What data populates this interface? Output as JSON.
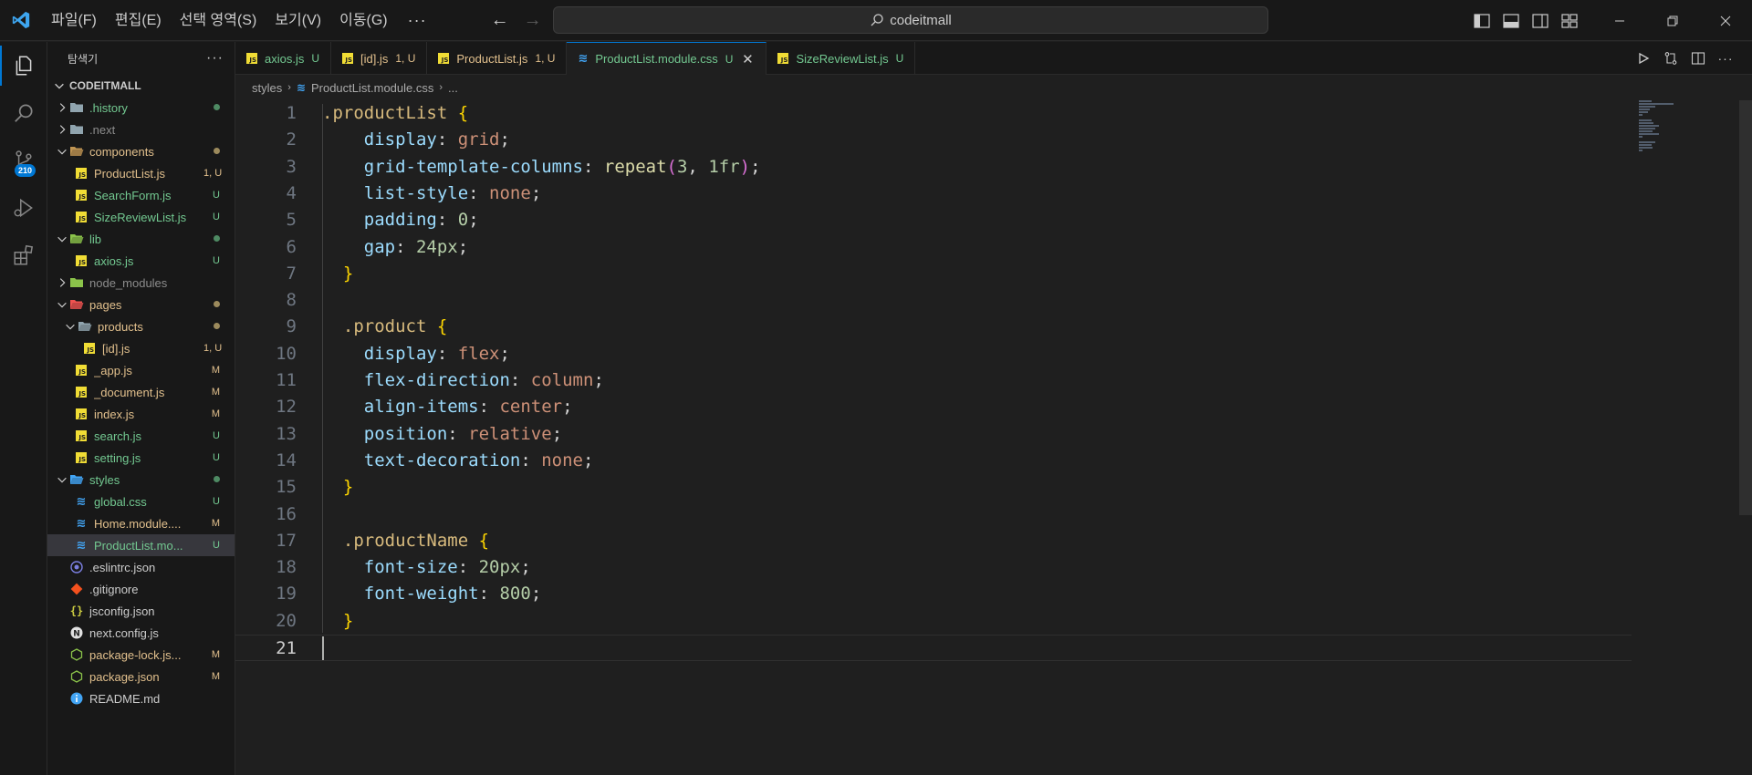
{
  "titlebar": {
    "menu": [
      "파일(F)",
      "편집(E)",
      "선택 영역(S)",
      "보기(V)",
      "이동(G)"
    ],
    "more": "···",
    "search_text": "codeitmall"
  },
  "activity": {
    "scm_badge": "210"
  },
  "sidebar": {
    "header": "탐색기",
    "more": "···",
    "root": "CODEITMALL"
  },
  "tree": [
    {
      "label": ".history",
      "type": "folder",
      "depth": 1,
      "open": false,
      "color": "untracked",
      "status": "dot",
      "icon": "folder-icon"
    },
    {
      "label": ".next",
      "type": "folder",
      "depth": 1,
      "open": false,
      "color": "ignored",
      "status": "",
      "icon": "folder-icon"
    },
    {
      "label": "components",
      "type": "folder",
      "depth": 1,
      "open": true,
      "color": "modified",
      "status": "dot",
      "icon": "folder-open-icon"
    },
    {
      "label": "ProductList.js",
      "type": "js",
      "depth": 2,
      "color": "modified",
      "status": "1, U",
      "icon": "js-file-icon"
    },
    {
      "label": "SearchForm.js",
      "type": "js",
      "depth": 2,
      "color": "untracked",
      "status": "U",
      "icon": "js-file-icon"
    },
    {
      "label": "SizeReviewList.js",
      "type": "js",
      "depth": 2,
      "color": "untracked",
      "status": "U",
      "icon": "js-file-icon"
    },
    {
      "label": "lib",
      "type": "folder",
      "depth": 1,
      "open": true,
      "color": "untracked",
      "status": "dot",
      "icon": "folder-open-icon"
    },
    {
      "label": "axios.js",
      "type": "js",
      "depth": 2,
      "color": "untracked",
      "status": "U",
      "icon": "js-file-icon"
    },
    {
      "label": "node_modules",
      "type": "folder",
      "depth": 1,
      "open": false,
      "color": "ignored",
      "status": "",
      "icon": "folder-icon"
    },
    {
      "label": "pages",
      "type": "folder",
      "depth": 1,
      "open": true,
      "color": "modified",
      "status": "dot",
      "icon": "folder-open-icon"
    },
    {
      "label": "products",
      "type": "folder",
      "depth": 2,
      "open": true,
      "color": "modified",
      "status": "dot",
      "icon": "folder-open-icon"
    },
    {
      "label": "[id].js",
      "type": "js",
      "depth": 3,
      "color": "modified",
      "status": "1, U",
      "icon": "js-file-icon"
    },
    {
      "label": "_app.js",
      "type": "js",
      "depth": 2,
      "color": "modified",
      "status": "M",
      "icon": "js-file-icon"
    },
    {
      "label": "_document.js",
      "type": "js",
      "depth": 2,
      "color": "modified",
      "status": "M",
      "icon": "js-file-icon"
    },
    {
      "label": "index.js",
      "type": "js",
      "depth": 2,
      "color": "modified",
      "status": "M",
      "icon": "js-file-icon"
    },
    {
      "label": "search.js",
      "type": "js",
      "depth": 2,
      "color": "untracked",
      "status": "U",
      "icon": "js-file-icon"
    },
    {
      "label": "setting.js",
      "type": "js",
      "depth": 2,
      "color": "untracked",
      "status": "U",
      "icon": "js-file-icon"
    },
    {
      "label": "styles",
      "type": "folder",
      "depth": 1,
      "open": true,
      "color": "untracked",
      "status": "dot",
      "icon": "folder-open-icon"
    },
    {
      "label": "global.css",
      "type": "css",
      "depth": 2,
      "color": "untracked",
      "status": "U",
      "icon": "css-file-icon"
    },
    {
      "label": "Home.module....",
      "type": "css",
      "depth": 2,
      "color": "modified",
      "status": "M",
      "icon": "css-file-icon"
    },
    {
      "label": "ProductList.mo...",
      "type": "css",
      "depth": 2,
      "color": "untracked",
      "status": "U",
      "icon": "css-file-icon",
      "selected": true
    },
    {
      "label": ".eslintrc.json",
      "type": "eslint",
      "depth": 1,
      "color": "default",
      "status": "",
      "icon": "eslint-icon"
    },
    {
      "label": ".gitignore",
      "type": "git",
      "depth": 1,
      "color": "default",
      "status": "",
      "icon": "git-icon"
    },
    {
      "label": "jsconfig.json",
      "type": "jsconfig",
      "depth": 1,
      "color": "default",
      "status": "",
      "icon": "jsconfig-icon"
    },
    {
      "label": "next.config.js",
      "type": "next",
      "depth": 1,
      "color": "default",
      "status": "",
      "icon": "next-icon"
    },
    {
      "label": "package-lock.js...",
      "type": "npm",
      "depth": 1,
      "color": "modified",
      "status": "M",
      "icon": "npm-icon"
    },
    {
      "label": "package.json",
      "type": "npm",
      "depth": 1,
      "color": "modified",
      "status": "M",
      "icon": "npm-icon"
    },
    {
      "label": "README.md",
      "type": "info",
      "depth": 1,
      "color": "default",
      "status": "",
      "icon": "info-icon"
    }
  ],
  "tabs": [
    {
      "label": "axios.js",
      "status": "U",
      "type": "js",
      "color": "untracked"
    },
    {
      "label": "[id].js",
      "status": "1, U",
      "type": "js",
      "color": "modified"
    },
    {
      "label": "ProductList.js",
      "status": "1, U",
      "type": "js",
      "color": "modified"
    },
    {
      "label": "ProductList.module.css",
      "status": "U",
      "type": "css",
      "color": "untracked",
      "active": true
    },
    {
      "label": "SizeReviewList.js",
      "status": "U",
      "type": "js",
      "color": "untracked"
    }
  ],
  "breadcrumb": {
    "folder": "styles",
    "file": "ProductList.module.css",
    "more": "..."
  },
  "editor": {
    "current_line": 21,
    "lines": [
      [
        [
          "sel",
          ".productList "
        ],
        [
          "brace",
          "{"
        ]
      ],
      [
        [
          "prop",
          "    display"
        ],
        [
          "punc",
          ": "
        ],
        [
          "val",
          "grid"
        ],
        [
          "punc",
          ";"
        ]
      ],
      [
        [
          "prop",
          "    grid-template-columns"
        ],
        [
          "punc",
          ": "
        ],
        [
          "fn",
          "repeat"
        ],
        [
          "paren",
          "("
        ],
        [
          "num",
          "3"
        ],
        [
          "punc",
          ", "
        ],
        [
          "num",
          "1fr"
        ],
        [
          "paren",
          ")"
        ],
        [
          "punc",
          ";"
        ]
      ],
      [
        [
          "prop",
          "    list-style"
        ],
        [
          "punc",
          ": "
        ],
        [
          "val",
          "none"
        ],
        [
          "punc",
          ";"
        ]
      ],
      [
        [
          "prop",
          "    padding"
        ],
        [
          "punc",
          ": "
        ],
        [
          "num",
          "0"
        ],
        [
          "punc",
          ";"
        ]
      ],
      [
        [
          "prop",
          "    gap"
        ],
        [
          "punc",
          ": "
        ],
        [
          "num",
          "24px"
        ],
        [
          "punc",
          ";"
        ]
      ],
      [
        [
          "brace",
          "  }"
        ]
      ],
      [],
      [
        [
          "sel",
          "  .product "
        ],
        [
          "brace",
          "{"
        ]
      ],
      [
        [
          "prop",
          "    display"
        ],
        [
          "punc",
          ": "
        ],
        [
          "val",
          "flex"
        ],
        [
          "punc",
          ";"
        ]
      ],
      [
        [
          "prop",
          "    flex-direction"
        ],
        [
          "punc",
          ": "
        ],
        [
          "val",
          "column"
        ],
        [
          "punc",
          ";"
        ]
      ],
      [
        [
          "prop",
          "    align-items"
        ],
        [
          "punc",
          ": "
        ],
        [
          "val",
          "center"
        ],
        [
          "punc",
          ";"
        ]
      ],
      [
        [
          "prop",
          "    position"
        ],
        [
          "punc",
          ": "
        ],
        [
          "val",
          "relative"
        ],
        [
          "punc",
          ";"
        ]
      ],
      [
        [
          "prop",
          "    text-decoration"
        ],
        [
          "punc",
          ": "
        ],
        [
          "val",
          "none"
        ],
        [
          "punc",
          ";"
        ]
      ],
      [
        [
          "brace",
          "  }"
        ]
      ],
      [],
      [
        [
          "sel",
          "  .productName "
        ],
        [
          "brace",
          "{"
        ]
      ],
      [
        [
          "prop",
          "    font-size"
        ],
        [
          "punc",
          ": "
        ],
        [
          "num",
          "20px"
        ],
        [
          "punc",
          ";"
        ]
      ],
      [
        [
          "prop",
          "    font-weight"
        ],
        [
          "punc",
          ": "
        ],
        [
          "num",
          "800"
        ],
        [
          "punc",
          ";"
        ]
      ],
      [
        [
          "brace",
          "  }"
        ]
      ],
      []
    ]
  },
  "colors": {
    "accent": "#0078d4",
    "untracked": "#73c991",
    "modified": "#e2c08d",
    "ignored": "#8c8c8c"
  }
}
